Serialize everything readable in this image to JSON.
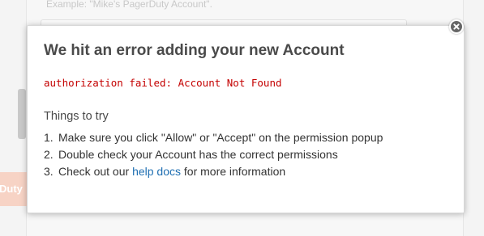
{
  "background": {
    "hint_text": "Example: \"Mike's PagerDuty Account\".",
    "brand_fragment": "Duty"
  },
  "modal": {
    "title": "We hit an error adding your new Account",
    "error_message": "authorization failed: Account Not Found",
    "subheading": "Things to try",
    "tips": [
      {
        "number": "1.",
        "text": "Make sure you click \"Allow\" or \"Accept\" on the permission popup"
      },
      {
        "number": "2.",
        "text": "Double check your Account has the correct permissions"
      },
      {
        "number": "3.",
        "text_before": "Check out our ",
        "link_text": "help docs",
        "text_after": " for more information"
      }
    ],
    "close_icon": "close-circle-icon"
  },
  "colors": {
    "error": "#c40000",
    "link": "#1f6fb2",
    "title": "#4a4a4a",
    "brand_faded": "#f7d3c5"
  }
}
